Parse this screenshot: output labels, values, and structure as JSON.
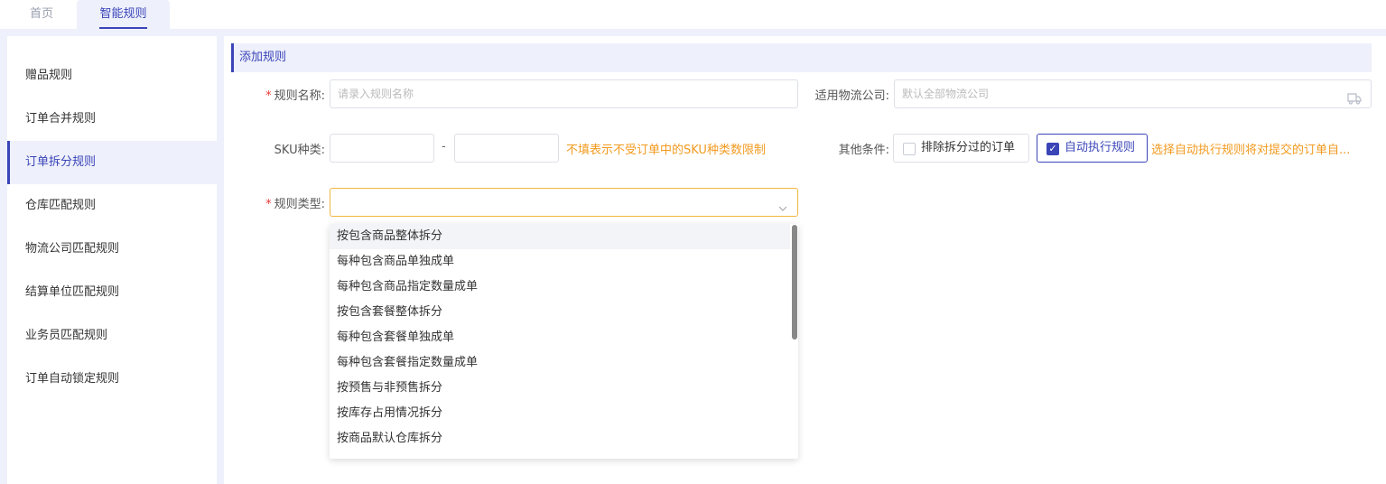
{
  "tabs": [
    {
      "label": "首页",
      "active": false
    },
    {
      "label": "智能规则",
      "active": true
    }
  ],
  "sidebar": {
    "items": [
      {
        "label": "赠品规则"
      },
      {
        "label": "订单合并规则"
      },
      {
        "label": "订单拆分规则",
        "active": true
      },
      {
        "label": "仓库匹配规则"
      },
      {
        "label": "物流公司匹配规则"
      },
      {
        "label": "结算单位匹配规则"
      },
      {
        "label": "业务员匹配规则"
      },
      {
        "label": "订单自动锁定规则"
      }
    ]
  },
  "form": {
    "section_title": "添加规则",
    "required_mark": "*",
    "rule_name": {
      "label": "规则名称:",
      "placeholder": "请录入规则名称",
      "value": ""
    },
    "logistics": {
      "label": "适用物流公司:",
      "placeholder": "默认全部物流公司",
      "value": ""
    },
    "sku": {
      "label": "SKU种类:",
      "min": "",
      "max": "",
      "separator": "-",
      "hint": "不填表示不受订单中的SKU种类数限制"
    },
    "other": {
      "label": "其他条件:",
      "exclude_split": {
        "label": "排除拆分过的订单",
        "checked": false
      },
      "auto_exec": {
        "label": "自动执行规则",
        "checked": true
      },
      "hint": "选择自动执行规则将对提交的订单自..."
    },
    "rule_type": {
      "label": "规则类型:",
      "value": "",
      "options": [
        "按包含商品整体拆分",
        "每种包含商品单独成单",
        "每种包含商品指定数量成单",
        "按包含套餐整体拆分",
        "每种包含套餐单独成单",
        "每种包含套餐指定数量成单",
        "按预售与非预售拆分",
        "按库存占用情况拆分",
        "按商品默认仓库拆分"
      ],
      "highlighted_index": 0
    }
  },
  "colors": {
    "accent": "#3a45b8",
    "warning": "#f29a1f",
    "required": "#e53935",
    "focus": "#f0b740"
  }
}
